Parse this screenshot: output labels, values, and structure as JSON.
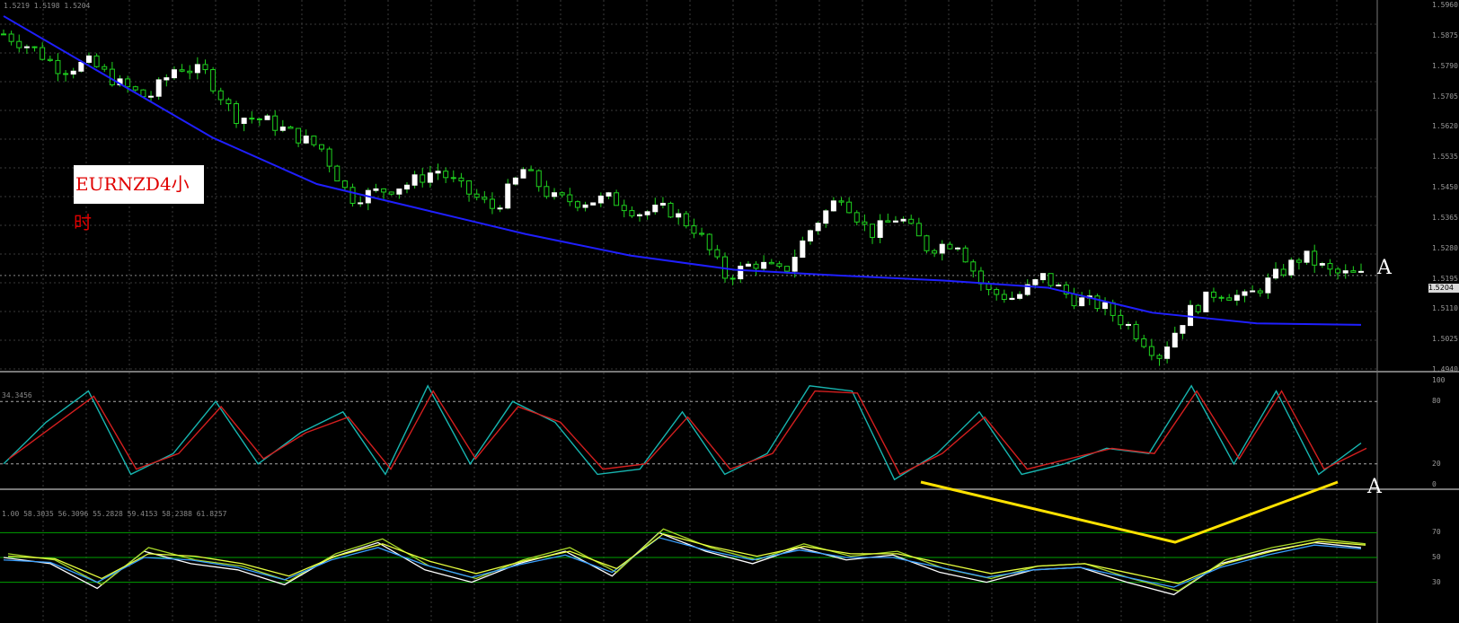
{
  "window": {
    "ohlc_header": "1.5219 1.5198 1.5204",
    "banner_label": "EURNZD4小时",
    "subpanel1_header": "34.3456",
    "subpanel2_header": "1.00 58.3035 56.3096 55.2828 59.4153 58.2388 61.8257",
    "marker_main": "A",
    "marker_osc": "A"
  },
  "price_axis": {
    "ticks": [
      "1.5960",
      "1.5875",
      "1.5790",
      "1.5705",
      "1.5620",
      "1.5535",
      "1.5450",
      "1.5365",
      "1.5280",
      "1.5195",
      "1.5110",
      "1.5025",
      "1.4940"
    ],
    "current_price": "1.5204"
  },
  "stoch_axis": {
    "ticks": [
      "100",
      "80",
      "20",
      "0"
    ]
  },
  "rsi_axis": {
    "ticks": [
      "70",
      "50",
      "30"
    ]
  },
  "colors": {
    "bull_candle": "#ffffff",
    "bear_candle": "#1fd21f",
    "wick": "#1fd21f",
    "moving_average": "#1f1fff",
    "stoch_main": "#17b5b0",
    "stoch_signal": "#d41f1f",
    "trendline": "#ffe200",
    "rsi_level": "#00a000",
    "grid": "#3a3a3a"
  },
  "chart_data": [
    {
      "type": "candlestick",
      "title": "EURNZD4小时",
      "ylim": [
        1.494,
        1.596
      ],
      "price_path": [
        1.588,
        1.584,
        1.578,
        1.58,
        1.574,
        1.57,
        1.579,
        1.577,
        1.565,
        1.564,
        1.56,
        1.556,
        1.542,
        1.544,
        1.546,
        1.55,
        1.544,
        1.539,
        1.55,
        1.542,
        1.541,
        1.542,
        1.538,
        1.539,
        1.533,
        1.52,
        1.524,
        1.521,
        1.534,
        1.543,
        1.532,
        1.537,
        1.528,
        1.53,
        1.516,
        1.514,
        1.52,
        1.514,
        1.512,
        1.506,
        1.498,
        1.51,
        1.516,
        1.514,
        1.52,
        1.526,
        1.521,
        1.5204
      ],
      "ma_path": [
        1.593,
        1.576,
        1.559,
        1.546,
        1.539,
        1.532,
        1.526,
        1.522,
        1.5204,
        1.519,
        1.517,
        1.51,
        1.507,
        1.5066
      ]
    },
    {
      "type": "line",
      "series": [
        {
          "values": [
            20,
            60,
            90,
            10,
            30,
            80,
            20,
            50,
            70,
            10,
            95,
            20,
            80,
            60,
            10,
            15,
            70,
            10,
            30,
            95,
            90,
            5,
            30,
            70,
            10,
            20,
            35,
            30,
            95,
            20,
            90,
            10,
            40
          ]
        },
        {
          "values": [
            25,
            55,
            85,
            15,
            30,
            75,
            25,
            50,
            65,
            15,
            90,
            25,
            75,
            60,
            15,
            20,
            65,
            15,
            30,
            90,
            88,
            10,
            30,
            65,
            15,
            25,
            35,
            30,
            90,
            25,
            90,
            15,
            35
          ]
        }
      ],
      "ylim": [
        0,
        100
      ]
    },
    {
      "type": "line",
      "series": [
        {
          "values": [
            50,
            45,
            25,
            55,
            45,
            40,
            28,
            50,
            62,
            40,
            30,
            45,
            55,
            35,
            70,
            55,
            45,
            58,
            48,
            52,
            38,
            30,
            40,
            42,
            30,
            20,
            45,
            55,
            62,
            58
          ]
        },
        {
          "values": [
            48,
            46,
            30,
            50,
            48,
            42,
            32,
            48,
            58,
            44,
            34,
            44,
            52,
            38,
            66,
            56,
            48,
            56,
            50,
            50,
            42,
            34,
            40,
            42,
            34,
            26,
            42,
            52,
            60,
            57
          ]
        }
      ],
      "ylim": [
        0,
        100
      ]
    }
  ]
}
